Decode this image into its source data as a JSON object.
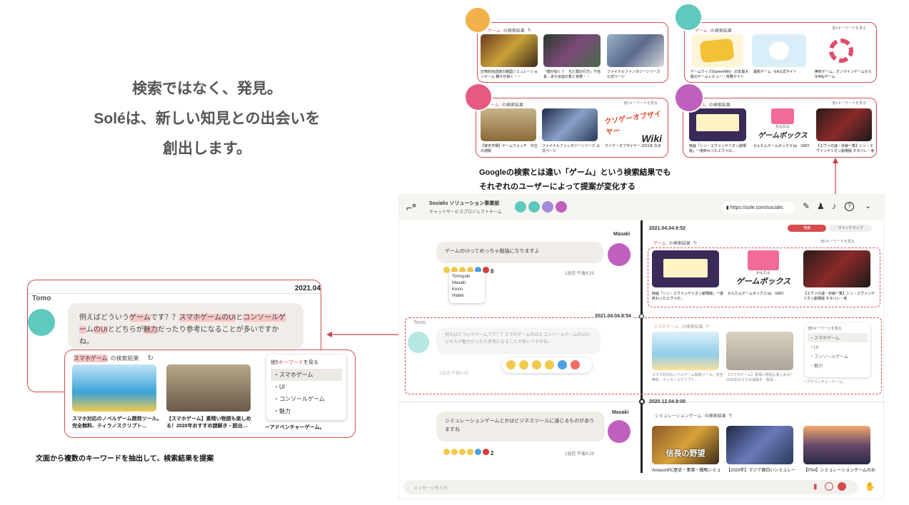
{
  "tagline": {
    "line1": "検索ではなく、発見。",
    "line2": "Soléは、新しい知見との出会いを",
    "line3": "創出します。"
  },
  "left_callout": {
    "user": "Tomo",
    "date": "2021.04",
    "msg_a": "例えばどういう",
    "msg_kw1": "ゲーム",
    "msg_b": "です？？",
    "msg_kw2": "スマホゲームのUI",
    "msg_c": "と",
    "msg_kw3": "コンソールゲー",
    "msg_d": "ム",
    "msg_kw4": "のUI",
    "msg_e": "とどちらが",
    "msg_kw5": "魅力",
    "msg_f": "だったり参考になることが多いですかね。",
    "results_title_kw": "スマホゲーム",
    "results_title": "の検索結果",
    "more_a": "他5",
    "more_kw": "キーワード",
    "more_b": "を見る",
    "menu": [
      "・スマホゲーム",
      "・UI",
      "・コンソールゲーム",
      "・魅力"
    ],
    "cap1": "スマホ対応のノベルゲーム開発ツール。完全無料、ティラノスクリプト…",
    "cap2": "【スマホゲーム】素晴い物語も楽しめる！2020年おすすめ謎解き・脱出…",
    "cap3": "ーアドベンチャーゲーム。"
  },
  "left_caption": "文面から複数のキーワードを抽出して、検索結果を提案",
  "top_cards": [
    {
      "title_kw": "ゲーム",
      "title": "の検索結果",
      "more": "他1キーワードを見る",
      "caps": [
        "圧倒的完成度の戦国シミュレーションゲーム 獅子が如く・・",
        "「龍が如く７　光と闇の行方」や信長…あら伝説の真と後際・・",
        "ファイナルファンタジーシリーズ 公式ページ"
      ]
    },
    {
      "title_kw": "ゲーム",
      "title": "の検索結果",
      "more": "他1キーワードを見る",
      "caps": [
        "ゲームウィズ(GameWith) - 日本最大級のゲームレビュー・攻略サイト",
        "最新ゲーム - EA公式サイト",
        "無料ゲーム、オンラインゲームならSHIftyゲーム"
      ]
    },
    {
      "title_kw": "ゲーム",
      "title": "の検索結果",
      "more": "他1キーワードを見る",
      "caps": [
        "【楽天市場】ゲームウォッチ　中古の通販",
        "ファイナルファンタジーシリーズ 公式ページ",
        "クソゲーオブザイヤー 2021年 次点"
      ]
    },
    {
      "title_kw": "ゲーム",
      "title": "の検索結果",
      "more": "他1キーワードを見る",
      "caps": [
        "映画「シン・エヴァンゲリオン劇場版」一度終わったエヴァの…",
        "かんたんゲームボックス by　GMO",
        "【エヴァの謎・伏線一覧】シン・エヴァンゲリオン劇場版 ネタバレ・考"
      ]
    }
  ],
  "wiki_text": "クソゲーオブザイヤー",
  "wiki_sub": "Wiki",
  "gamebox_text": "かんたん",
  "gamebox_text2": "ゲームボックス",
  "middle_caption_1": "Googleの検索とは違い「ゲーム」という検索結果でも",
  "middle_caption_2": "それぞれのユーザーによって提案が変化する",
  "app": {
    "org": "Socialis ソリューション事業部",
    "channel": "チャットサービスプロジェクトチーム",
    "url": "https://sole.com/socialis",
    "tab_search": "検索",
    "tab_mindmap": "マインドマップ",
    "msg1_user": "Masaki",
    "msg1_text": "ゲームのUIってめっちゃ勉強になりますよ",
    "msg1_count": "8",
    "msg1_reply": "1返信 午後9:29",
    "reactors": [
      "Tomoyuki",
      "Masaki",
      "Kevin",
      "Hideki"
    ],
    "msg2_user": "Tomo",
    "msg2_text": "例えばどういうゲームです？？スマホゲームのUIとコンソールゲームのUIとどちらが魅力だったり参考になることが多いですかね。",
    "msg2_reply": "1返信 午後9:29",
    "msg3_user": "Masaki",
    "msg3_text": "シミュレーションゲームとかはビジネスツールに通じるものがありますね",
    "msg3_count": "2",
    "msg3_reply": "1返信 午後9:29",
    "date1": "2021.04.04.8:52",
    "date2": "2021.04.04.8:54",
    "date3": "2020.12.04.9:00",
    "panel1_title_kw": "ゲーム",
    "panel1_title": "の検索結果",
    "panel1_more": "他1キーワードを見る",
    "panel1_caps": [
      "映画「シン・エヴァンゲリオン劇場版」一度終わったエヴァの…",
      "かんたんゲームボックス by　GMO",
      "【エヴァの謎・伏線一覧】シン・エヴァンゲリオン劇場版 ネタバレ・考"
    ],
    "panel2_title_kw": "スマホゲーム",
    "panel2_title": "の検索結果",
    "panel2_more": "他5キーワードを見る",
    "panel2_menu": [
      "・スマホゲーム",
      "・UI",
      "・コンソールゲーム",
      "・魅力"
    ],
    "panel2_caps": [
      "スマホ対応のノベルゲーム開発ツール。完全無料、ティラノスクリプト…",
      "【スマホゲーム】素晴い物語も楽しめる！2020年おすすめ謎解き・脱出…",
      "ーアドベンチャーゲーム。"
    ],
    "panel3_title_kw": "シミュレーションゲーム",
    "panel3_title": "の検索結果",
    "panel3_caps": [
      "AmasonPC歴史・軍事・戦略シミュ",
      "【2020年】マジで面白いシミュレー",
      "【PS4】シミュレーションゲームのお"
    ],
    "nobunaga": "信長の野望",
    "input_placeholder": "メッセージを入力"
  },
  "colors": {
    "accent": "#d64d4d",
    "avatar_teal": "#5ec9bd",
    "avatar_purple": "#c05fbe",
    "avatar_orange": "#f2b14a",
    "avatar_pink": "#e65a82"
  }
}
